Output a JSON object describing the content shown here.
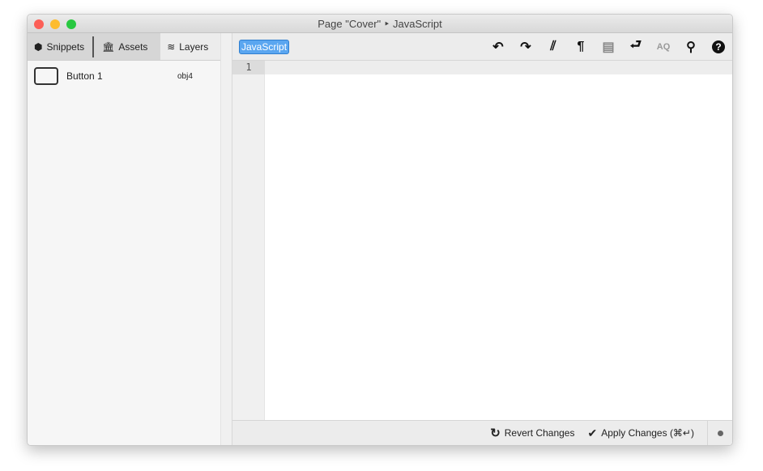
{
  "window": {
    "title": "Page \"Cover\" ‣ JavaScript"
  },
  "tabs": [
    {
      "label": "Snippets",
      "icon": "cube-icon"
    },
    {
      "label": "Assets",
      "icon": "bank-icon"
    },
    {
      "label": "Layers",
      "icon": "layers-icon"
    }
  ],
  "layers": [
    {
      "name": "Button 1",
      "id": "obj4"
    }
  ],
  "editor": {
    "language": "JavaScript",
    "line_numbers": [
      "1"
    ]
  },
  "toolbar": {
    "icons": [
      "undo-icon",
      "redo-icon",
      "stripes-icon",
      "pilcrow-icon",
      "outline-icon",
      "wrap-icon",
      "replace-icon",
      "search-icon",
      "help-icon"
    ]
  },
  "footer": {
    "revert": "Revert Changes",
    "apply": "Apply Changes (⌘↵)"
  }
}
